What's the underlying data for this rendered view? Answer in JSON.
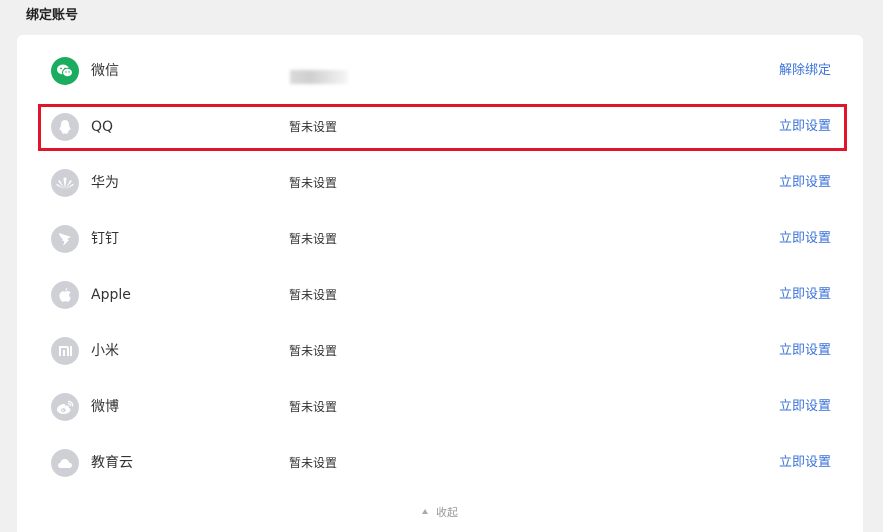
{
  "section_title": "绑定账号",
  "accounts": [
    {
      "name": "微信",
      "status": "",
      "action": "解除绑定",
      "icon": "wechat-icon",
      "bound": true
    },
    {
      "name": "QQ",
      "status": "暂未设置",
      "action": "立即设置",
      "icon": "qq-icon"
    },
    {
      "name": "华为",
      "status": "暂未设置",
      "action": "立即设置",
      "icon": "huawei-icon"
    },
    {
      "name": "钉钉",
      "status": "暂未设置",
      "action": "立即设置",
      "icon": "dingtalk-icon"
    },
    {
      "name": "Apple",
      "status": "暂未设置",
      "action": "立即设置",
      "icon": "apple-icon"
    },
    {
      "name": "小米",
      "status": "暂未设置",
      "action": "立即设置",
      "icon": "xiaomi-icon"
    },
    {
      "name": "微博",
      "status": "暂未设置",
      "action": "立即设置",
      "icon": "weibo-icon"
    },
    {
      "name": "教育云",
      "status": "暂未设置",
      "action": "立即设置",
      "icon": "cloud-icon"
    }
  ],
  "collapse_label": "收起",
  "colors": {
    "link": "#3b73d9",
    "wechat": "#1aad5f",
    "icon_bg": "#cfcfd6",
    "highlight": "#e0142a"
  }
}
